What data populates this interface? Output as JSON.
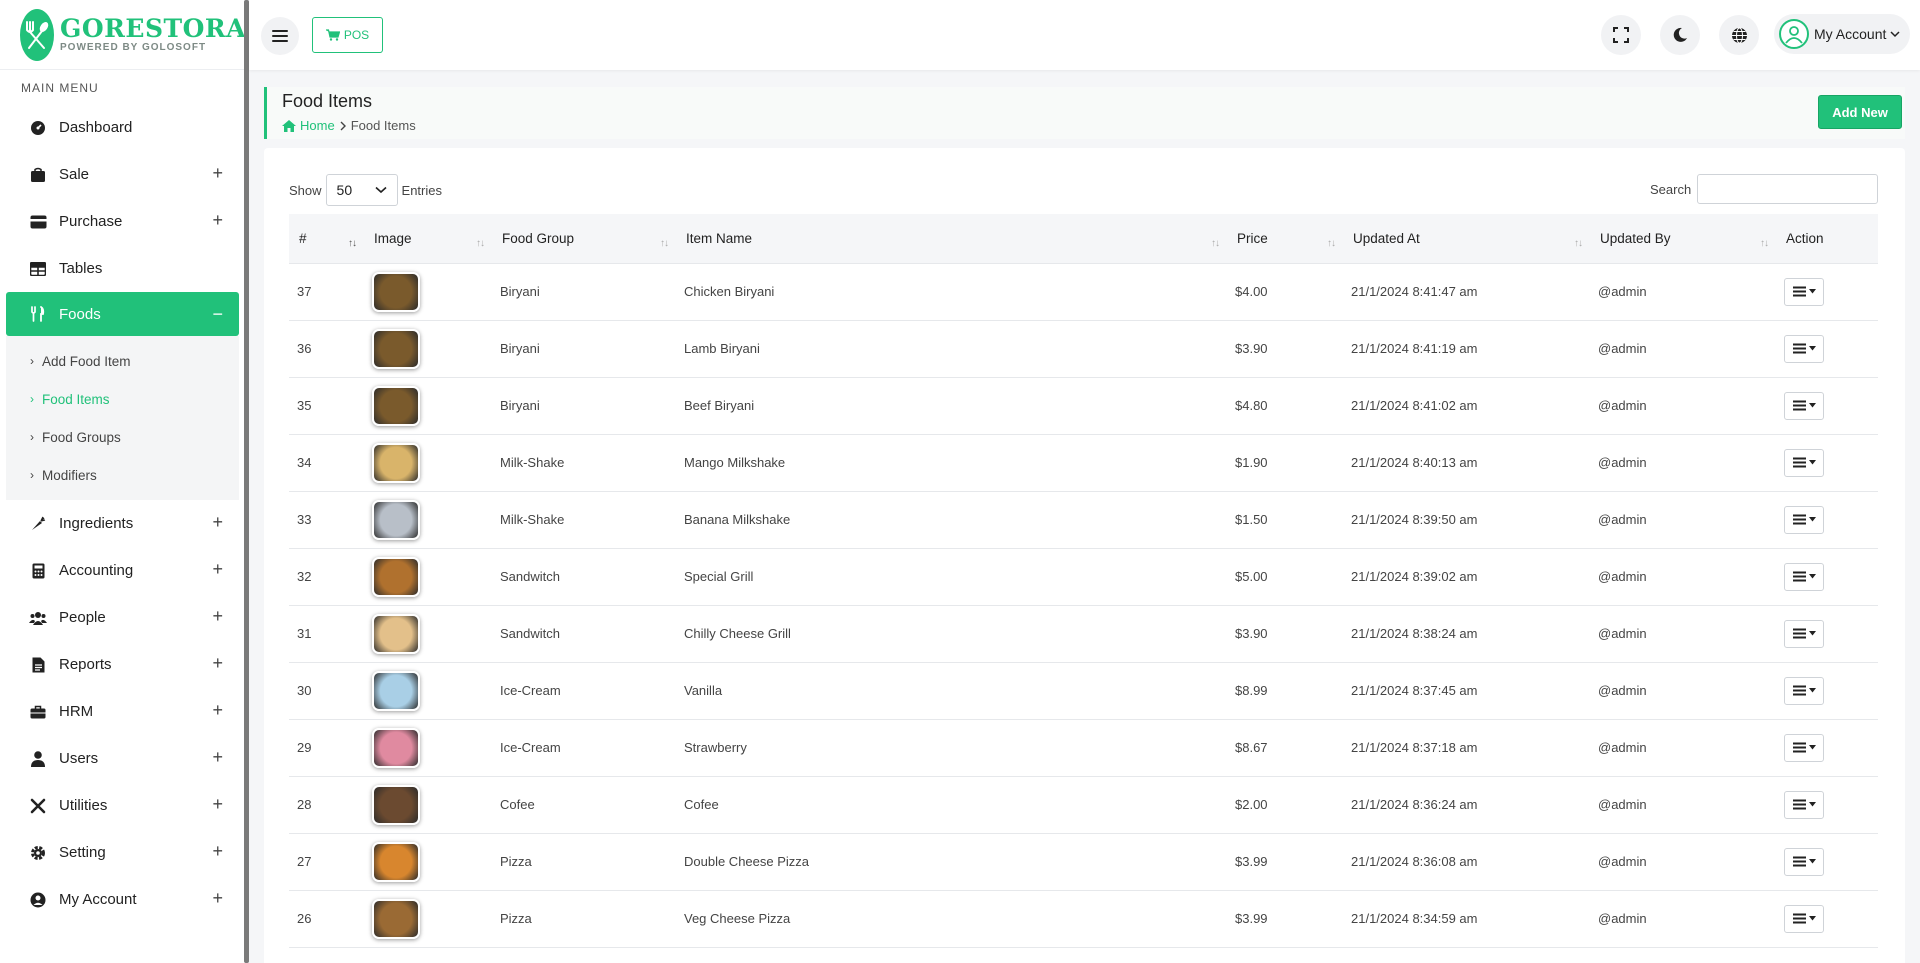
{
  "brand": {
    "name": "GORESTORA",
    "tagline": "POWERED BY GOLOSOFT"
  },
  "sidebar": {
    "caption": "MAIN MENU",
    "items": [
      {
        "label": "Dashboard",
        "icon": "gauge-icon",
        "expand": ""
      },
      {
        "label": "Sale",
        "icon": "bag-icon",
        "expand": "+"
      },
      {
        "label": "Purchase",
        "icon": "card-icon",
        "expand": "+"
      },
      {
        "label": "Tables",
        "icon": "table-icon",
        "expand": ""
      },
      {
        "label": "Foods",
        "icon": "utensils-icon",
        "expand": "−"
      },
      {
        "label": "Ingredients",
        "icon": "carrot-icon",
        "expand": "+"
      },
      {
        "label": "Accounting",
        "icon": "calculator-icon",
        "expand": "+"
      },
      {
        "label": "People",
        "icon": "people-icon",
        "expand": "+"
      },
      {
        "label": "Reports",
        "icon": "report-icon",
        "expand": "+"
      },
      {
        "label": "HRM",
        "icon": "briefcase-icon",
        "expand": "+"
      },
      {
        "label": "Users",
        "icon": "user-icon",
        "expand": "+"
      },
      {
        "label": "Utilities",
        "icon": "tools-icon",
        "expand": "+"
      },
      {
        "label": "Setting",
        "icon": "gear-icon",
        "expand": "+"
      },
      {
        "label": "My Account",
        "icon": "user-circle-icon",
        "expand": "+"
      }
    ],
    "foods_submenu": [
      {
        "label": "Add Food Item"
      },
      {
        "label": "Food Items"
      },
      {
        "label": "Food Groups"
      },
      {
        "label": "Modifiers"
      }
    ]
  },
  "topbar": {
    "pos_label": "POS",
    "account_label": "My Account"
  },
  "page": {
    "title": "Food Items",
    "breadcrumb_home": "Home",
    "breadcrumb_current": "Food Items",
    "add_new_label": "Add New"
  },
  "table_controls": {
    "show_label": "Show",
    "entries_value": "50",
    "entries_label": "Entries",
    "search_label": "Search"
  },
  "table": {
    "columns": [
      "#",
      "Image",
      "Food Group",
      "Item Name",
      "Price",
      "Updated At",
      "Updated By",
      "Action"
    ],
    "rows": [
      {
        "id": "37",
        "group": "Biryani",
        "name": "Chicken Biryani",
        "price": "$4.00",
        "updated_at": "21/1/2024 8:41:47 am",
        "updated_by": "@admin",
        "thumb": "#7a5a2c"
      },
      {
        "id": "36",
        "group": "Biryani",
        "name": "Lamb Biryani",
        "price": "$3.90",
        "updated_at": "21/1/2024 8:41:19 am",
        "updated_by": "@admin",
        "thumb": "#7a5a2c"
      },
      {
        "id": "35",
        "group": "Biryani",
        "name": "Beef Biryani",
        "price": "$4.80",
        "updated_at": "21/1/2024 8:41:02 am",
        "updated_by": "@admin",
        "thumb": "#7a5a2c"
      },
      {
        "id": "34",
        "group": "Milk-Shake",
        "name": "Mango Milkshake",
        "price": "$1.90",
        "updated_at": "21/1/2024 8:40:13 am",
        "updated_by": "@admin",
        "thumb": "#d9b46a"
      },
      {
        "id": "33",
        "group": "Milk-Shake",
        "name": "Banana Milkshake",
        "price": "$1.50",
        "updated_at": "21/1/2024 8:39:50 am",
        "updated_by": "@admin",
        "thumb": "#b8bfc8"
      },
      {
        "id": "32",
        "group": "Sandwitch",
        "name": "Special Grill",
        "price": "$5.00",
        "updated_at": "21/1/2024 8:39:02 am",
        "updated_by": "@admin",
        "thumb": "#b0712e"
      },
      {
        "id": "31",
        "group": "Sandwitch",
        "name": "Chilly Cheese Grill",
        "price": "$3.90",
        "updated_at": "21/1/2024 8:38:24 am",
        "updated_by": "@admin",
        "thumb": "#e3c08a"
      },
      {
        "id": "30",
        "group": "Ice-Cream",
        "name": "Vanilla",
        "price": "$8.99",
        "updated_at": "21/1/2024 8:37:45 am",
        "updated_by": "@admin",
        "thumb": "#a9cfe6"
      },
      {
        "id": "29",
        "group": "Ice-Cream",
        "name": "Strawberry",
        "price": "$8.67",
        "updated_at": "21/1/2024 8:37:18 am",
        "updated_by": "@admin",
        "thumb": "#e08aa0"
      },
      {
        "id": "28",
        "group": "Cofee",
        "name": "Cofee",
        "price": "$2.00",
        "updated_at": "21/1/2024 8:36:24 am",
        "updated_by": "@admin",
        "thumb": "#6b4a30"
      },
      {
        "id": "27",
        "group": "Pizza",
        "name": "Double Cheese Pizza",
        "price": "$3.99",
        "updated_at": "21/1/2024 8:36:08 am",
        "updated_by": "@admin",
        "thumb": "#d8862e"
      },
      {
        "id": "26",
        "group": "Pizza",
        "name": "Veg Cheese Pizza",
        "price": "$3.99",
        "updated_at": "21/1/2024 8:34:59 am",
        "updated_by": "@admin",
        "thumb": "#9a6a34"
      }
    ]
  },
  "colors": {
    "accent": "#21c17a",
    "text": "#222222"
  }
}
